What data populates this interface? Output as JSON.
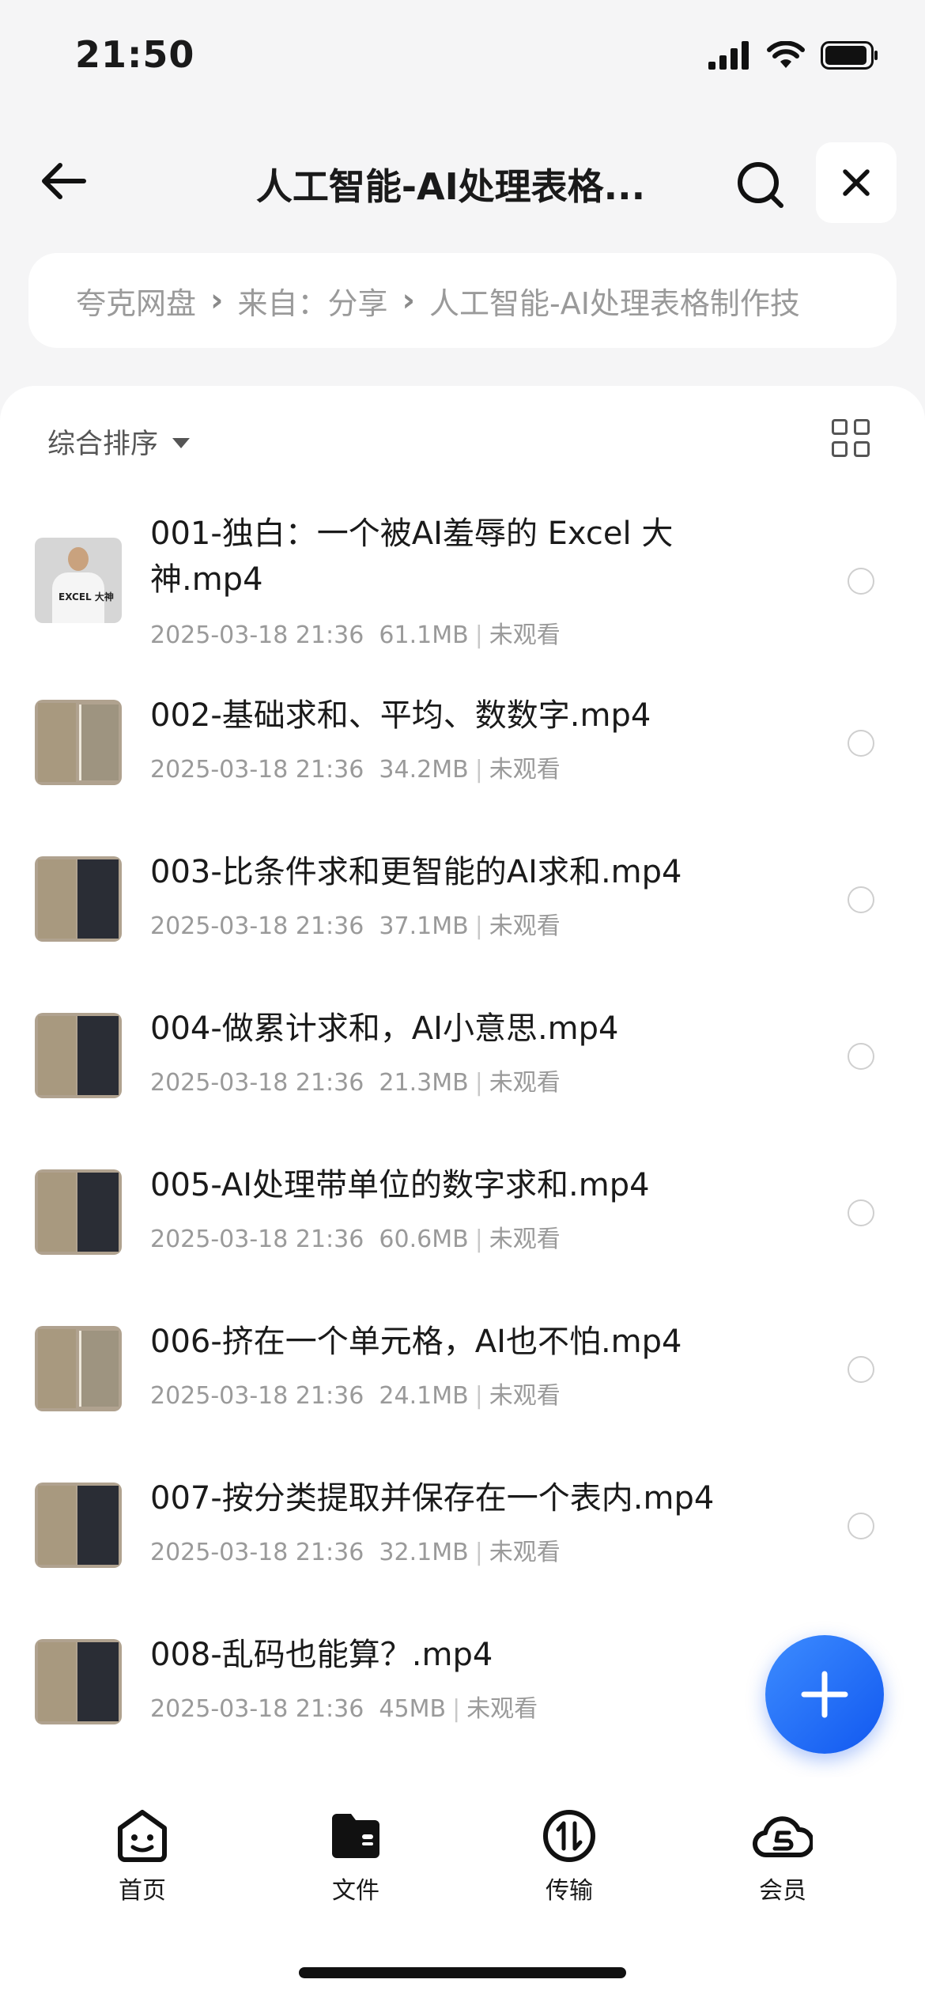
{
  "status_bar": {
    "time": "21:50"
  },
  "nav": {
    "title": "人工智能-AI处理表格..."
  },
  "breadcrumb": {
    "items": [
      "夸克网盘",
      "来自：分享",
      "人工智能-AI处理表格制作技"
    ]
  },
  "toolbar": {
    "sort_label": "综合排序"
  },
  "files": [
    {
      "name": "001-独白：一个被AI羞辱的 Excel 大神.mp4",
      "date": "2025-03-18 21:36",
      "size": "61.1MB",
      "status": "未观看"
    },
    {
      "name": "002-基础求和、平均、数数字.mp4",
      "date": "2025-03-18 21:36",
      "size": "34.2MB",
      "status": "未观看"
    },
    {
      "name": "003-比条件求和更智能的AI求和.mp4",
      "date": "2025-03-18 21:36",
      "size": "37.1MB",
      "status": "未观看"
    },
    {
      "name": "004-做累计求和，AI小意思.mp4",
      "date": "2025-03-18 21:36",
      "size": "21.3MB",
      "status": "未观看"
    },
    {
      "name": "005-AI处理带单位的数字求和.mp4",
      "date": "2025-03-18 21:36",
      "size": "60.6MB",
      "status": "未观看"
    },
    {
      "name": "006-挤在一个单元格，AI也不怕.mp4",
      "date": "2025-03-18 21:36",
      "size": "24.1MB",
      "status": "未观看"
    },
    {
      "name": "007-按分类提取并保存在一个表内.mp4",
      "date": "2025-03-18 21:36",
      "size": "32.1MB",
      "status": "未观看"
    },
    {
      "name": "008-乱码也能算？.mp4",
      "date": "2025-03-18 21:36",
      "size": "45MB",
      "status": "未观看"
    }
  ],
  "thumb_text": "EXCEL 大神",
  "tabs": [
    {
      "label": "首页",
      "icon": "smile-face-icon"
    },
    {
      "label": "文件",
      "icon": "folder-icon"
    },
    {
      "label": "传输",
      "icon": "transfer-icon"
    },
    {
      "label": "会员",
      "icon": "cloud-s-icon"
    }
  ],
  "colors": {
    "accent": "#1a6bff",
    "text": "#1a1a1a",
    "muted": "#9a9a9a",
    "background": "#f5f5f6"
  }
}
